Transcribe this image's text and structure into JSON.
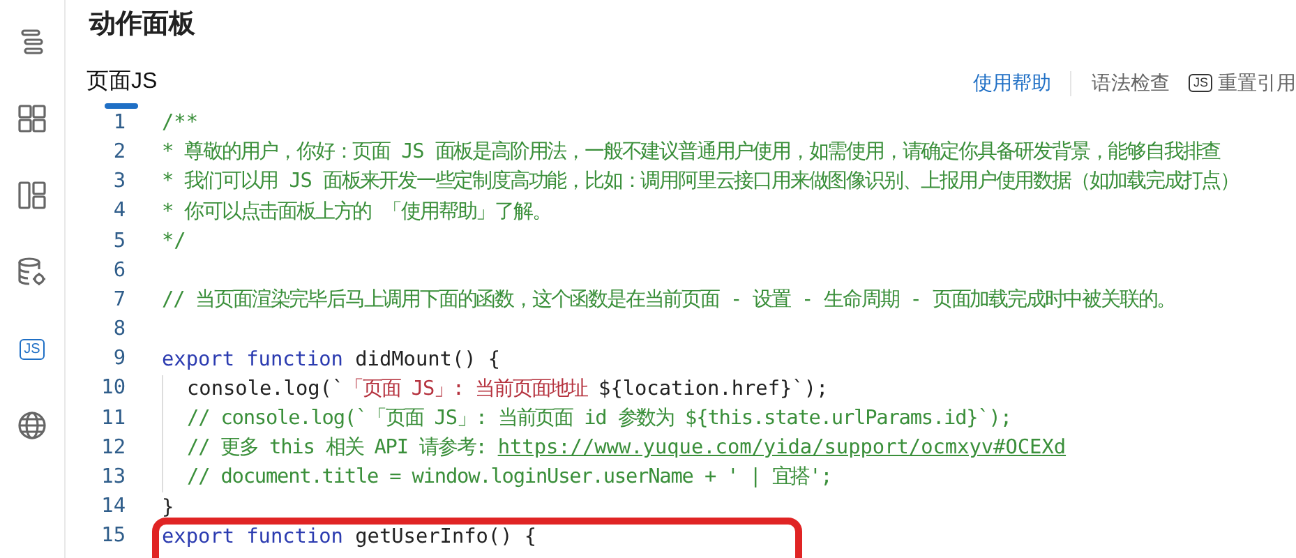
{
  "sidebar": {
    "items": [
      {
        "selected": false
      },
      {
        "selected": false
      },
      {
        "selected": false
      },
      {
        "selected": false
      },
      {
        "badge": "JS",
        "selected": true
      },
      {
        "selected": false
      }
    ]
  },
  "panel": {
    "title": "动作面板"
  },
  "tabs": [
    {
      "label": "页面JS",
      "selected": true
    }
  ],
  "toolbar": [
    {
      "kind": "link",
      "label": "使用帮助"
    },
    {
      "kind": "action",
      "label": "语法检查"
    },
    {
      "kind": "js-action",
      "badge": "JS",
      "label": "重置引用"
    }
  ],
  "code": {
    "lines": [
      {
        "number": "1",
        "tokens": [
          {
            "kind": "comment",
            "text": "/**"
          }
        ]
      },
      {
        "number": "2",
        "tokens": [
          {
            "kind": "comment",
            "text": "* 尊敬的用户，你好：页面 JS 面板是高阶用法，一般不建议普通用户使用，如需使用，请确定你具备研发背景，能够自我排查"
          }
        ]
      },
      {
        "number": "3",
        "tokens": [
          {
            "kind": "comment",
            "text": "* 我们可以用 JS 面板来开发一些定制度高功能，比如：调用阿里云接口用来做图像识别、上报用户使用数据（如加载完成打点）"
          }
        ]
      },
      {
        "number": "4",
        "tokens": [
          {
            "kind": "comment",
            "text": "* 你可以点击面板上方的 「使用帮助」了解。"
          }
        ]
      },
      {
        "number": "5",
        "tokens": [
          {
            "kind": "comment",
            "text": "*/"
          }
        ]
      },
      {
        "number": "6"
      },
      {
        "number": "7",
        "tokens": [
          {
            "kind": "comment",
            "text": "// 当页面渲染完毕后马上调用下面的函数，这个函数是在当前页面 - 设置 - 生命周期 - 页面加载完成时中被关联的。"
          }
        ]
      },
      {
        "number": "8"
      },
      {
        "number": "9",
        "tokens": [
          {
            "kind": "keyword",
            "text": "export function"
          },
          {
            "kind": "plain",
            "text": " didMount() {"
          }
        ]
      },
      {
        "number": "10",
        "indented": true,
        "tokens": [
          {
            "kind": "plain",
            "text": "console.log(`"
          },
          {
            "kind": "string",
            "text": "「页面 JS」: 当前页面地址 "
          },
          {
            "kind": "plain",
            "text": "${location.href}`);"
          }
        ]
      },
      {
        "number": "11",
        "indented": true,
        "tokens": [
          {
            "kind": "comment",
            "text": "// console.log(`「页面 JS」: 当前页面 id 参数为 ${this.state.urlParams.id}`);"
          }
        ]
      },
      {
        "number": "12",
        "indented": true,
        "tokens": [
          {
            "kind": "comment",
            "text": "// 更多 this 相关 API 请参考: "
          },
          {
            "kind": "link",
            "text": "https://www.yuque.com/yida/support/ocmxyv#OCEXd"
          }
        ]
      },
      {
        "number": "13",
        "indented": true,
        "tokens": [
          {
            "kind": "comment",
            "text": "// document.title = window.loginUser.userName + ' | 宜搭';"
          }
        ]
      },
      {
        "number": "14",
        "tokens": [
          {
            "kind": "plain",
            "text": "}"
          }
        ]
      },
      {
        "number": "15",
        "highlighted": true,
        "tokens": [
          {
            "kind": "keyword",
            "text": "export function"
          },
          {
            "kind": "plain",
            "text": " getUserInfo() {"
          }
        ]
      }
    ]
  }
}
